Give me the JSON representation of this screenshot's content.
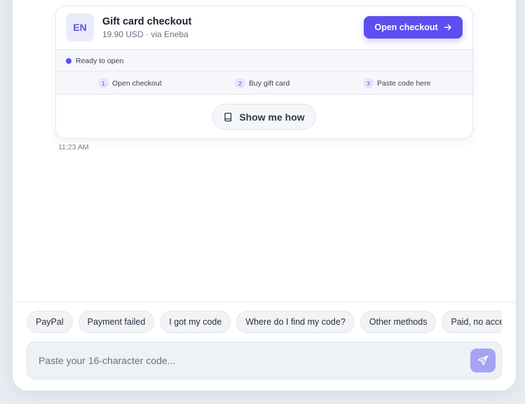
{
  "checkout_card": {
    "avatar_text": "EN",
    "title": "Gift card checkout",
    "subtitle": "19.90 USD · via Eneba",
    "open_button": "Open checkout",
    "status": "Ready to open",
    "steps": [
      {
        "num": "1",
        "label": "Open checkout"
      },
      {
        "num": "2",
        "label": "Buy gift card"
      },
      {
        "num": "3",
        "label": "Paste code here"
      }
    ],
    "show_button": "Show me how"
  },
  "message_time": "11:23 AM",
  "quick_replies": [
    "PayPal",
    "Payment failed",
    "I got my code",
    "Where do I find my code?",
    "Other methods",
    "Paid, no access"
  ],
  "composer": {
    "placeholder": "Paste your 16-character code..."
  },
  "colors": {
    "accent": "#5b4ff0",
    "accent_light": "#a6a3f3"
  },
  "icons": {
    "open_button": "arrow-right-icon",
    "show_button": "book-icon",
    "send": "send-icon"
  }
}
